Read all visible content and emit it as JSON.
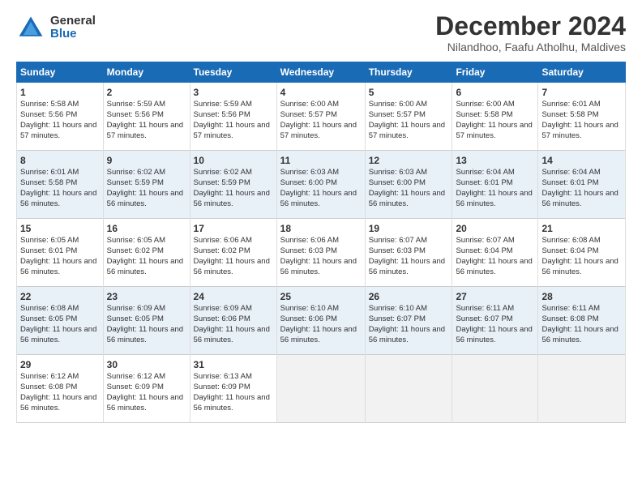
{
  "header": {
    "logo_general": "General",
    "logo_blue": "Blue",
    "title": "December 2024",
    "location": "Nilandhoo, Faafu Atholhu, Maldives"
  },
  "days_of_week": [
    "Sunday",
    "Monday",
    "Tuesday",
    "Wednesday",
    "Thursday",
    "Friday",
    "Saturday"
  ],
  "weeks": [
    [
      {
        "day": "1",
        "sunrise": "5:58 AM",
        "sunset": "5:56 PM",
        "daylight": "11 hours and 57 minutes"
      },
      {
        "day": "2",
        "sunrise": "5:59 AM",
        "sunset": "5:56 PM",
        "daylight": "11 hours and 57 minutes"
      },
      {
        "day": "3",
        "sunrise": "5:59 AM",
        "sunset": "5:56 PM",
        "daylight": "11 hours and 57 minutes"
      },
      {
        "day": "4",
        "sunrise": "6:00 AM",
        "sunset": "5:57 PM",
        "daylight": "11 hours and 57 minutes"
      },
      {
        "day": "5",
        "sunrise": "6:00 AM",
        "sunset": "5:57 PM",
        "daylight": "11 hours and 57 minutes"
      },
      {
        "day": "6",
        "sunrise": "6:00 AM",
        "sunset": "5:58 PM",
        "daylight": "11 hours and 57 minutes"
      },
      {
        "day": "7",
        "sunrise": "6:01 AM",
        "sunset": "5:58 PM",
        "daylight": "11 hours and 57 minutes"
      }
    ],
    [
      {
        "day": "8",
        "sunrise": "6:01 AM",
        "sunset": "5:58 PM",
        "daylight": "11 hours and 56 minutes"
      },
      {
        "day": "9",
        "sunrise": "6:02 AM",
        "sunset": "5:59 PM",
        "daylight": "11 hours and 56 minutes"
      },
      {
        "day": "10",
        "sunrise": "6:02 AM",
        "sunset": "5:59 PM",
        "daylight": "11 hours and 56 minutes"
      },
      {
        "day": "11",
        "sunrise": "6:03 AM",
        "sunset": "6:00 PM",
        "daylight": "11 hours and 56 minutes"
      },
      {
        "day": "12",
        "sunrise": "6:03 AM",
        "sunset": "6:00 PM",
        "daylight": "11 hours and 56 minutes"
      },
      {
        "day": "13",
        "sunrise": "6:04 AM",
        "sunset": "6:01 PM",
        "daylight": "11 hours and 56 minutes"
      },
      {
        "day": "14",
        "sunrise": "6:04 AM",
        "sunset": "6:01 PM",
        "daylight": "11 hours and 56 minutes"
      }
    ],
    [
      {
        "day": "15",
        "sunrise": "6:05 AM",
        "sunset": "6:01 PM",
        "daylight": "11 hours and 56 minutes"
      },
      {
        "day": "16",
        "sunrise": "6:05 AM",
        "sunset": "6:02 PM",
        "daylight": "11 hours and 56 minutes"
      },
      {
        "day": "17",
        "sunrise": "6:06 AM",
        "sunset": "6:02 PM",
        "daylight": "11 hours and 56 minutes"
      },
      {
        "day": "18",
        "sunrise": "6:06 AM",
        "sunset": "6:03 PM",
        "daylight": "11 hours and 56 minutes"
      },
      {
        "day": "19",
        "sunrise": "6:07 AM",
        "sunset": "6:03 PM",
        "daylight": "11 hours and 56 minutes"
      },
      {
        "day": "20",
        "sunrise": "6:07 AM",
        "sunset": "6:04 PM",
        "daylight": "11 hours and 56 minutes"
      },
      {
        "day": "21",
        "sunrise": "6:08 AM",
        "sunset": "6:04 PM",
        "daylight": "11 hours and 56 minutes"
      }
    ],
    [
      {
        "day": "22",
        "sunrise": "6:08 AM",
        "sunset": "6:05 PM",
        "daylight": "11 hours and 56 minutes"
      },
      {
        "day": "23",
        "sunrise": "6:09 AM",
        "sunset": "6:05 PM",
        "daylight": "11 hours and 56 minutes"
      },
      {
        "day": "24",
        "sunrise": "6:09 AM",
        "sunset": "6:06 PM",
        "daylight": "11 hours and 56 minutes"
      },
      {
        "day": "25",
        "sunrise": "6:10 AM",
        "sunset": "6:06 PM",
        "daylight": "11 hours and 56 minutes"
      },
      {
        "day": "26",
        "sunrise": "6:10 AM",
        "sunset": "6:07 PM",
        "daylight": "11 hours and 56 minutes"
      },
      {
        "day": "27",
        "sunrise": "6:11 AM",
        "sunset": "6:07 PM",
        "daylight": "11 hours and 56 minutes"
      },
      {
        "day": "28",
        "sunrise": "6:11 AM",
        "sunset": "6:08 PM",
        "daylight": "11 hours and 56 minutes"
      }
    ],
    [
      {
        "day": "29",
        "sunrise": "6:12 AM",
        "sunset": "6:08 PM",
        "daylight": "11 hours and 56 minutes"
      },
      {
        "day": "30",
        "sunrise": "6:12 AM",
        "sunset": "6:09 PM",
        "daylight": "11 hours and 56 minutes"
      },
      {
        "day": "31",
        "sunrise": "6:13 AM",
        "sunset": "6:09 PM",
        "daylight": "11 hours and 56 minutes"
      },
      null,
      null,
      null,
      null
    ]
  ]
}
